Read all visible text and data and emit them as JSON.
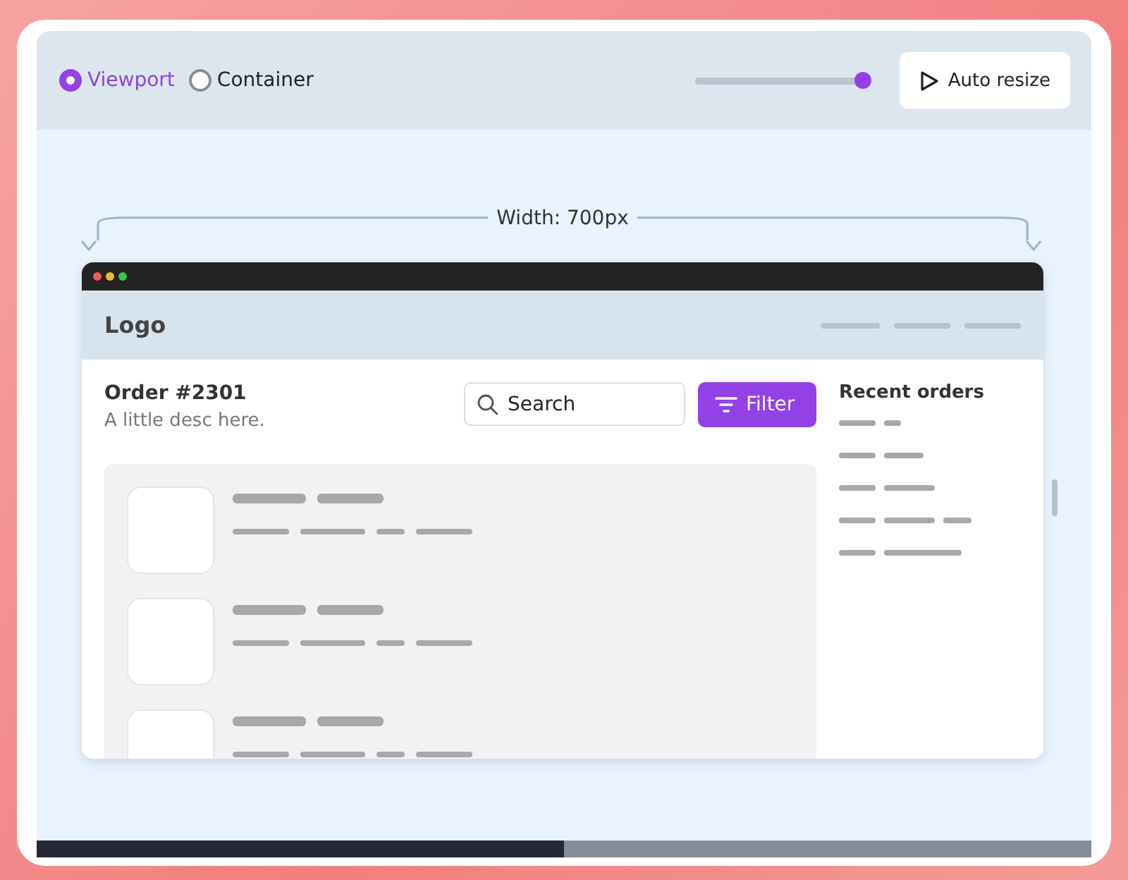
{
  "toolbar": {
    "modes": [
      {
        "label": "Viewport",
        "selected": true
      },
      {
        "label": "Container",
        "selected": false
      }
    ],
    "slider": {
      "level": 0.95
    },
    "button": {
      "label": "Auto resize"
    }
  },
  "dimension": {
    "label": "Width: 700px"
  },
  "preview": {
    "logo": "Logo",
    "title": "Order #2301",
    "description": "A little desc here.",
    "search": {
      "placeholder": "Search"
    },
    "filter_button": "Filter",
    "sidebar_title": "Recent orders"
  }
}
